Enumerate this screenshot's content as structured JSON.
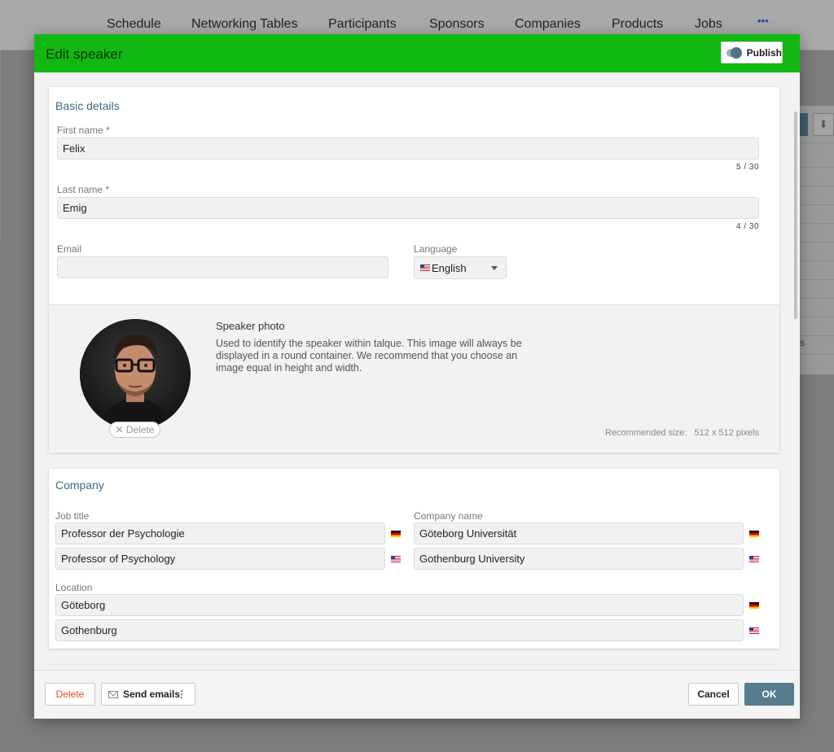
{
  "nav": {
    "items": [
      "Schedule",
      "Networking Tables",
      "Participants",
      "Sponsors",
      "Companies",
      "Products",
      "Jobs"
    ],
    "more_label": "•••"
  },
  "modal": {
    "title": "Edit speaker",
    "publish_label": "Publish"
  },
  "basic": {
    "title": "Basic details",
    "first_name_label": "First name",
    "first_name_value": "Felix",
    "first_name_counter": "5 / 30",
    "last_name_label": "Last name",
    "last_name_value": "Emig",
    "last_name_counter": "4 / 30",
    "required_mark": "*",
    "email_label": "Email",
    "email_value": "",
    "language_label": "Language",
    "language_value": "English",
    "language_flag": "us-flag"
  },
  "photo": {
    "title": "Speaker photo",
    "description": "Used to identify the speaker within talque. This image will always be displayed in a round container. We recommend that you choose an image equal in height and width.",
    "delete_label": "✕ Delete",
    "recommended_label": "Recommended size:",
    "recommended_value": "512 x 512 pixels"
  },
  "company": {
    "title": "Company",
    "job_title_label": "Job title",
    "job_title_de": "Professor der Psychologie",
    "job_title_en": "Professor of Psychology",
    "company_name_label": "Company name",
    "company_name_de": "Göteborg Universität",
    "company_name_en": "Gothenburg University",
    "location_label": "Location",
    "location_de": "Göteborg",
    "location_en": "Gothenburg"
  },
  "footer": {
    "delete_label": "Delete",
    "send_emails_label": "Send emails",
    "send_emails_more": "⋮",
    "cancel_label": "Cancel",
    "ok_label": "OK"
  },
  "background": {
    "right_cut_text": "s"
  },
  "colors": {
    "header_green": "#12b812",
    "accent_teal": "#557d8d",
    "title_blue": "#3b6a82",
    "delete_red": "#e64a2a"
  }
}
